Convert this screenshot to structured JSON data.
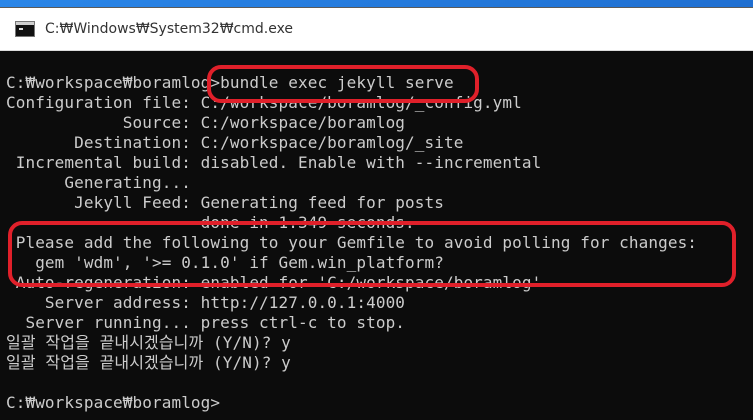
{
  "window": {
    "title": "C:₩Windows₩System32₩cmd.exe",
    "icon": "console-icon"
  },
  "console": {
    "lines": [
      "C:₩workspace₩boramlog>bundle exec jekyll serve",
      "Configuration file: C:/workspace/boramlog/_config.yml",
      "            Source: C:/workspace/boramlog",
      "       Destination: C:/workspace/boramlog/_site",
      " Incremental build: disabled. Enable with --incremental",
      "      Generating...",
      "       Jekyll Feed: Generating feed for posts",
      "                    done in 1.349 seconds.",
      " Please add the following to your Gemfile to avoid polling for changes:",
      "   gem 'wdm', '>= 0.1.0' if Gem.win_platform?",
      " Auto-regeneration: enabled for 'C:/workspace/boramlog'",
      "    Server address: http://127.0.0.1:4000",
      "  Server running... press ctrl-c to stop.",
      "일괄 작업을 끝내시겠습니까 (Y/N)? y",
      "일괄 작업을 끝내시겠습니까 (Y/N)? y",
      "",
      "C:₩workspace₩boramlog>"
    ]
  },
  "annotations": {
    "color": "#e0202a",
    "items": [
      "command-highlight",
      "gemfile-warning-highlight"
    ]
  }
}
